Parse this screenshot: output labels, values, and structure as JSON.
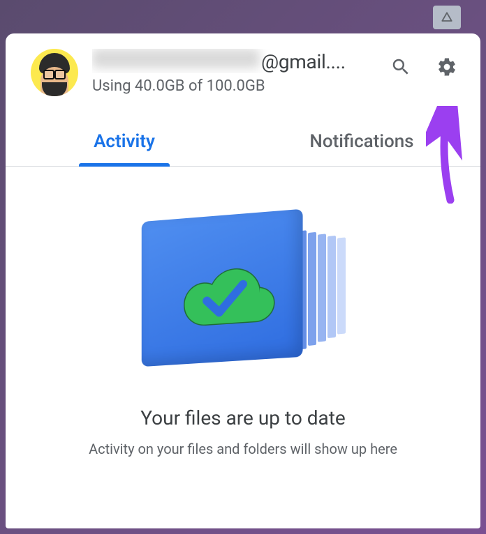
{
  "account": {
    "email_visible_suffix": "@gmail....",
    "storage_line": "Using 40.0GB of 100.0GB"
  },
  "tabs": {
    "activity": "Activity",
    "notifications": "Notifications"
  },
  "status": {
    "title": "Your files are up to date",
    "subtitle": "Activity on your files and folders will show up here"
  },
  "icons": {
    "titlebar": "drive-triangle-icon",
    "search": "search-icon",
    "settings": "gear-icon"
  },
  "colors": {
    "accent": "#1a73e8",
    "hint_arrow": "#9b3ff0"
  }
}
